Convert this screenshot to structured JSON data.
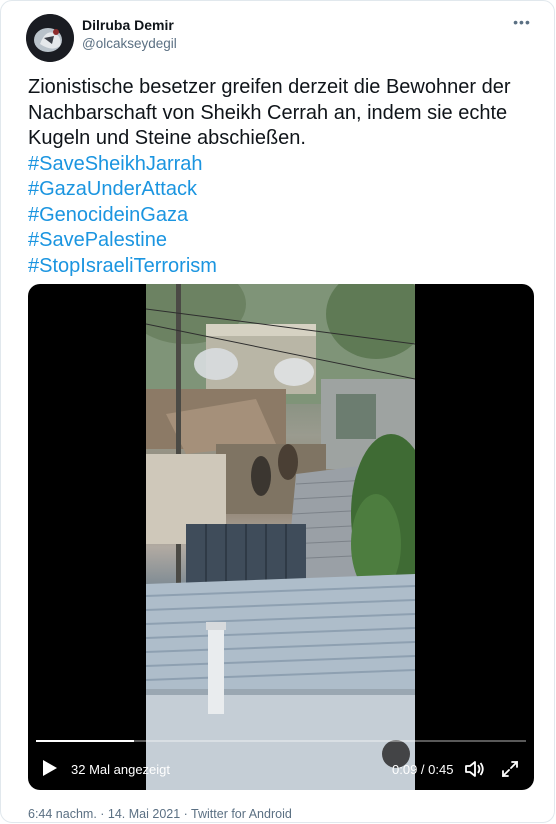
{
  "author": {
    "name": "Dilruba Demir",
    "handle": "@olcakseydegil"
  },
  "tweet": {
    "text": "Zionistische besetzer greifen derzeit die Bewohner der Nachbarschaft von Sheikh Cerrah an, indem sie echte Kugeln und Steine abschießen.",
    "hashtags": [
      "#SaveSheikhJarrah",
      "#GazaUnderAttack",
      "#GenocideinGaza",
      "#SavePalestine",
      "#StopIsraeliTerrorism"
    ]
  },
  "video": {
    "views": "32 Mal angezeigt",
    "time": "0:09 / 0:45",
    "progress_fraction": 0.2,
    "icons": {
      "play": "play-icon",
      "volume": "volume-icon",
      "fullscreen": "fullscreen-icon"
    }
  },
  "meta": {
    "timestamp": "6:44 nachm. · 14. Mai 2021 · Twitter for Android"
  },
  "more_icon": "more-icon",
  "colors": {
    "link": "#1b95e0",
    "secondary_text": "#5b7083",
    "border": "#e1e8ed"
  }
}
